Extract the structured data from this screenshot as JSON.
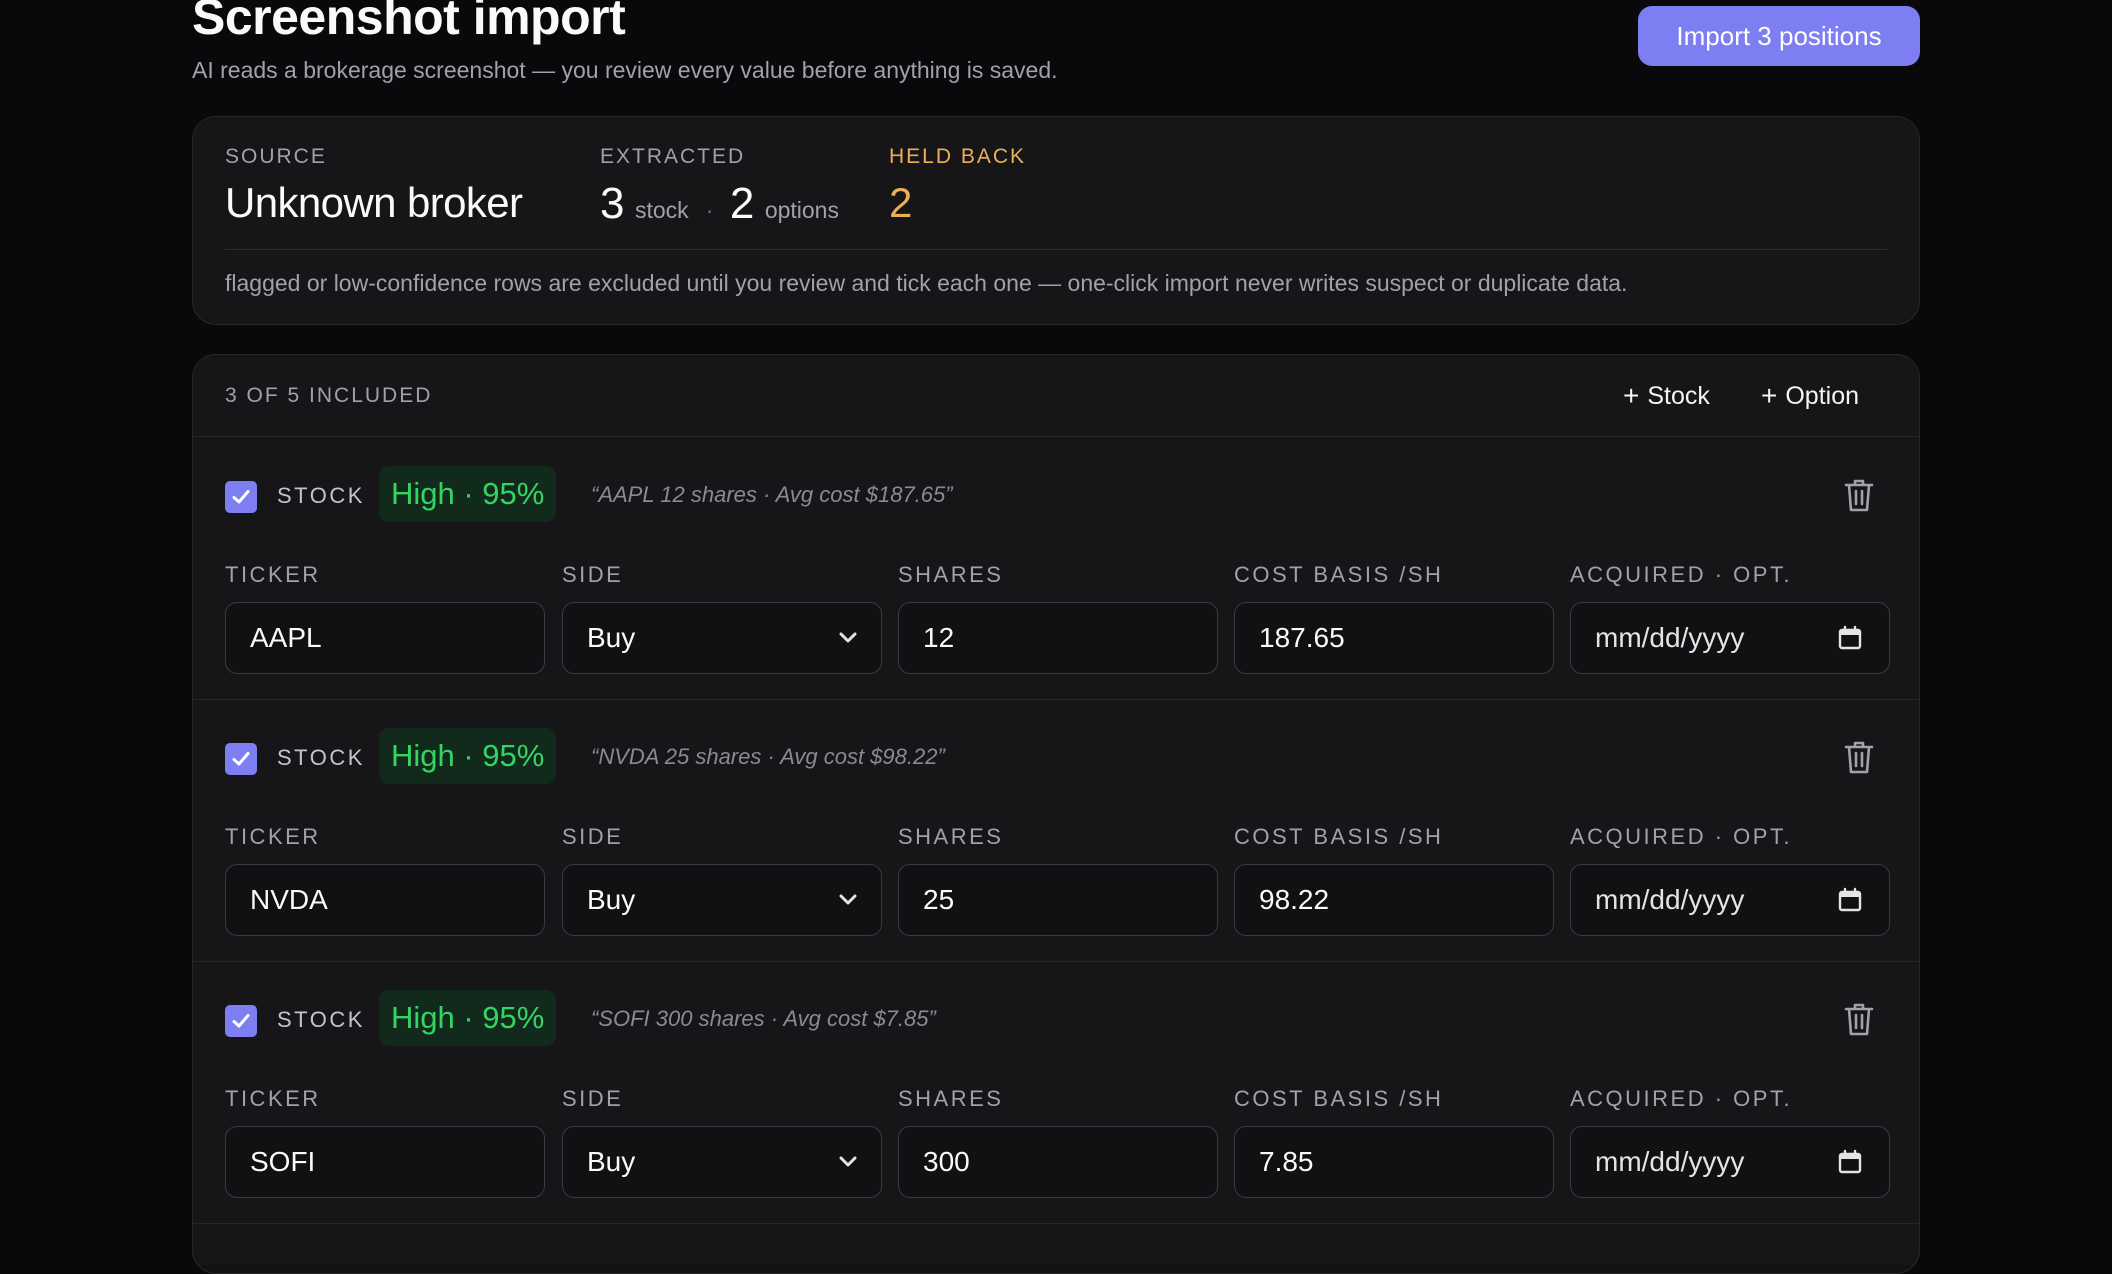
{
  "header": {
    "title": "Screenshot import",
    "subtitle": "AI reads a brokerage screenshot — you review every value before anything is saved.",
    "import_button": "Import 3 positions"
  },
  "summary": {
    "source_label": "SOURCE",
    "source_value": "Unknown broker",
    "extracted_label": "EXTRACTED",
    "stock_count": "3",
    "stock_unit": "stock",
    "separator": "·",
    "option_count": "2",
    "option_unit": "options",
    "held_back_label": "HELD BACK",
    "held_back_value": "2",
    "note": "flagged or low-confidence rows are excluded until you review and tick each one — one-click import never writes suspect or duplicate data."
  },
  "panel": {
    "included_label": "3 OF 5 INCLUDED",
    "add_stock": "Stock",
    "add_option": "Option",
    "field_labels": {
      "ticker": "TICKER",
      "side": "SIDE",
      "shares": "SHARES",
      "cost_basis": "COST BASIS /SH",
      "acquired": "ACQUIRED · OPT."
    },
    "rows": [
      {
        "checked": true,
        "type": "STOCK",
        "confidence": "High · 95%",
        "quote": "“AAPL 12 shares · Avg cost $187.65”",
        "ticker": "AAPL",
        "side": "Buy",
        "shares": "12",
        "cost_basis": "187.65",
        "acquired_placeholder": "mm/dd/yyyy"
      },
      {
        "checked": true,
        "type": "STOCK",
        "confidence": "High · 95%",
        "quote": "“NVDA 25 shares · Avg cost $98.22”",
        "ticker": "NVDA",
        "side": "Buy",
        "shares": "25",
        "cost_basis": "98.22",
        "acquired_placeholder": "mm/dd/yyyy"
      },
      {
        "checked": true,
        "type": "STOCK",
        "confidence": "High · 95%",
        "quote": "“SOFI 300 shares · Avg cost $7.85”",
        "ticker": "SOFI",
        "side": "Buy",
        "shares": "300",
        "cost_basis": "7.85",
        "acquired_placeholder": "mm/dd/yyyy"
      }
    ]
  },
  "colors": {
    "accent": "#7c7ef2",
    "success": "#34d463",
    "warning": "#eab056",
    "background": "#09090b",
    "card": "#161618"
  },
  "icons": {
    "checkbox": "check-icon",
    "delete": "trash-icon",
    "select": "chevron-down-icon",
    "date": "calendar-icon",
    "add": "plus-icon"
  }
}
